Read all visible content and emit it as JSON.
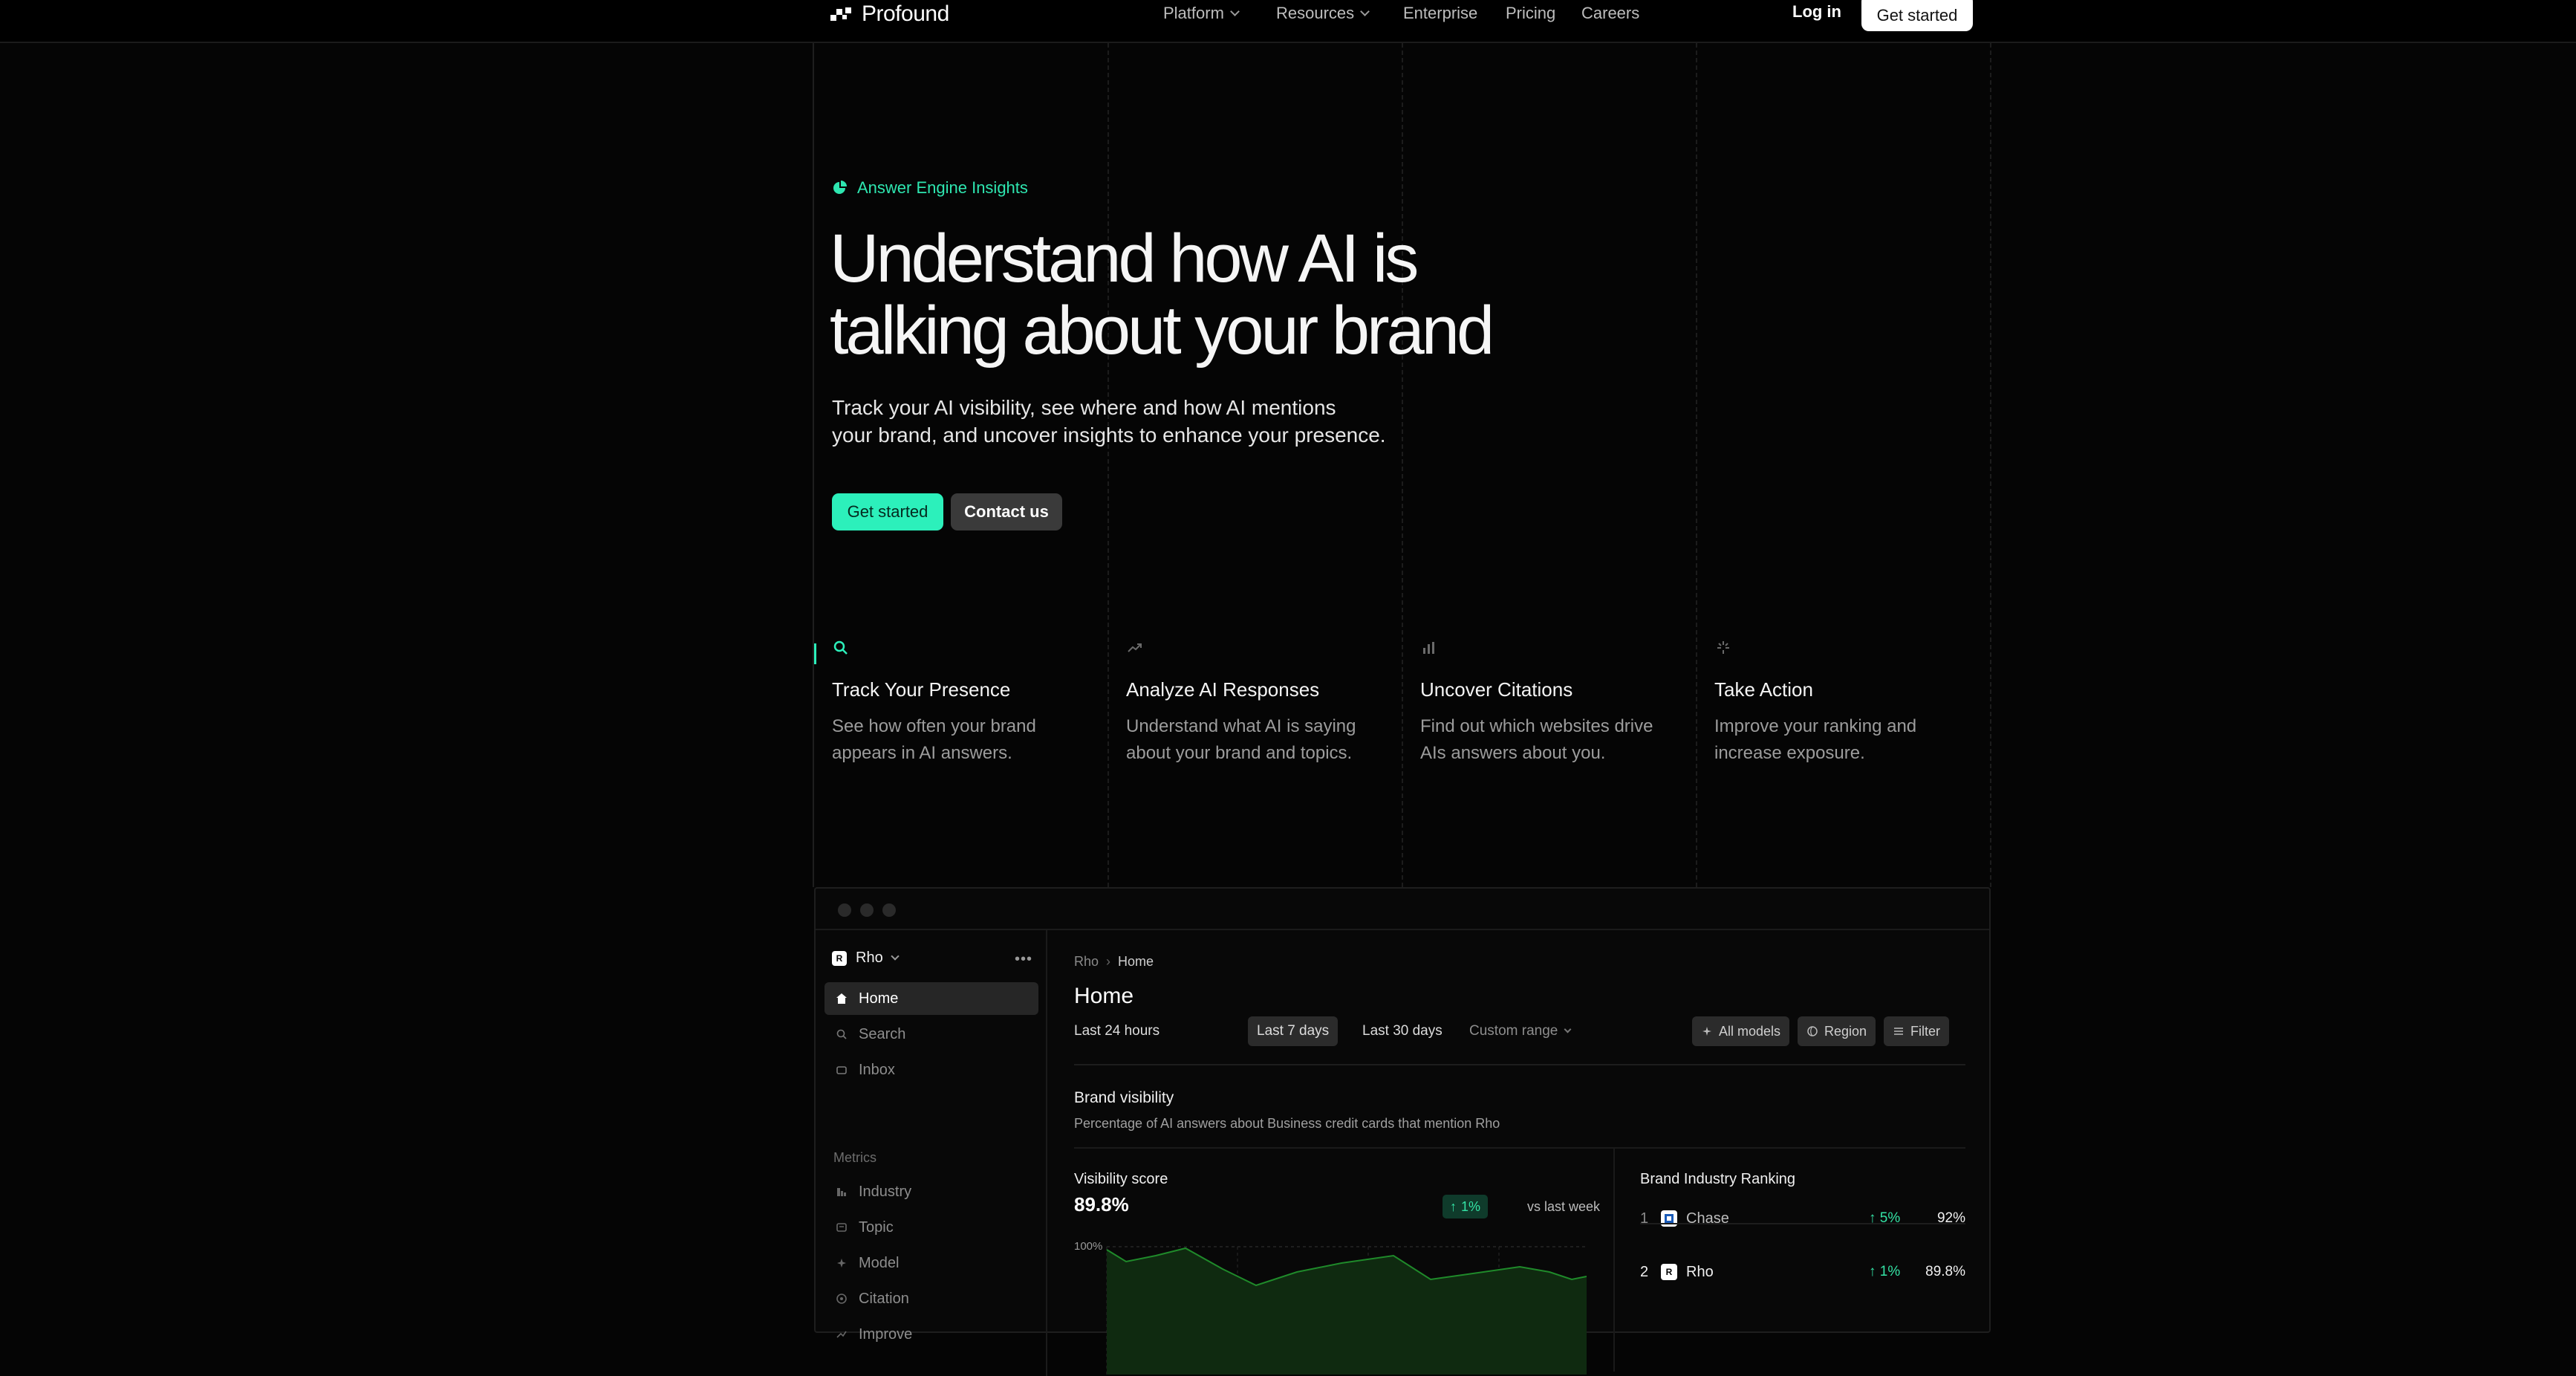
{
  "nav": {
    "brand": "Profound",
    "links": [
      "Platform",
      "Resources",
      "Enterprise",
      "Pricing",
      "Careers"
    ],
    "login": "Log in",
    "cta": "Get started"
  },
  "hero": {
    "badge": "Answer Engine Insights",
    "headline_line1": "Understand how AI is",
    "headline_line2": "talking about your brand",
    "subtitle_line1": "Track your AI visibility, see where and how AI mentions",
    "subtitle_line2": "your brand, and uncover insights to enhance your presence.",
    "primary_button": "Get started",
    "secondary_button": "Contact us"
  },
  "features": [
    {
      "icon": "search-icon",
      "title": "Track Your Presence",
      "desc_line1": "See how often your brand",
      "desc_line2": "appears in AI answers."
    },
    {
      "icon": "trend-icon",
      "title": "Analyze AI Responses",
      "desc_line1": "Understand what AI is saying",
      "desc_line2": "about your brand and topics."
    },
    {
      "icon": "bar-chart-icon",
      "title": "Uncover Citations",
      "desc_line1": "Find out which websites drive",
      "desc_line2": "AIs answers about you."
    },
    {
      "icon": "sparkle-icon",
      "title": "Take Action",
      "desc_line1": "Improve your ranking and",
      "desc_line2": "increase exposure."
    }
  ],
  "app": {
    "workspace": "Rho",
    "sidebar": [
      {
        "label": "Home",
        "icon": "home-icon",
        "active": true
      },
      {
        "label": "Search",
        "icon": "search-icon"
      },
      {
        "label": "Inbox",
        "icon": "inbox-icon"
      }
    ],
    "metrics_label": "Metrics",
    "metrics": [
      {
        "label": "Industry",
        "icon": "industry-icon"
      },
      {
        "label": "Topic",
        "icon": "topic-icon"
      },
      {
        "label": "Model",
        "icon": "model-icon"
      },
      {
        "label": "Citation",
        "icon": "citation-icon"
      },
      {
        "label": "Improve",
        "icon": "improve-icon"
      }
    ],
    "breadcrumb": [
      "Rho",
      "Home"
    ],
    "page_title": "Home",
    "ranges": [
      "Last 24 hours",
      "Last 7 days",
      "Last 30 days",
      "Custom range"
    ],
    "active_range": "Last 7 days",
    "filters": [
      "All models",
      "Region",
      "Filter"
    ],
    "brand_visibility": {
      "title": "Brand visibility",
      "description": "Percentage of AI answers about Business credit cards that mention Rho"
    },
    "visibility_score": {
      "label": "Visibility score",
      "value": "89.8%",
      "delta": "1%",
      "comparison": "vs last week",
      "axis_label": "100%"
    },
    "ranking": {
      "title": "Brand Industry Ranking",
      "rows": [
        {
          "rank": "1",
          "name": "Chase",
          "delta": "5%",
          "value": "92%"
        },
        {
          "rank": "2",
          "name": "Rho",
          "delta": "1%",
          "value": "89.8%"
        }
      ]
    },
    "colors": {
      "accent": "#2cf0bb",
      "positive": "#34e3a5",
      "chart_fill": "#0f2a10",
      "chart_line": "#1f8a2a"
    }
  }
}
